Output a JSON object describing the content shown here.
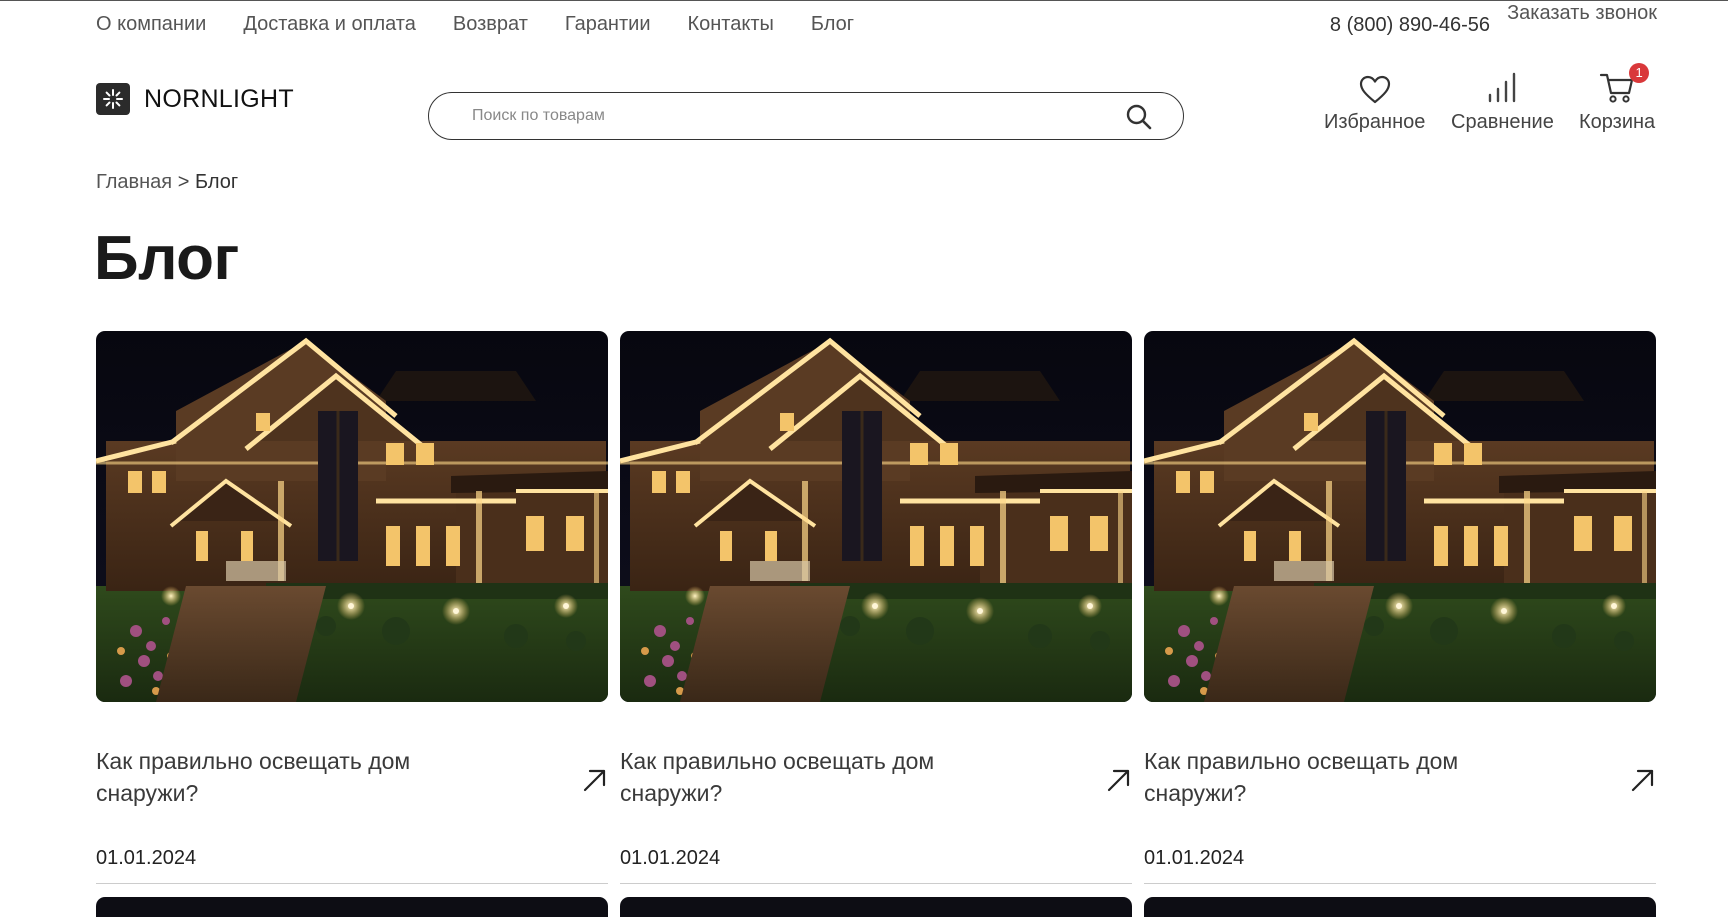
{
  "top_nav": [
    {
      "label": "О компании"
    },
    {
      "label": "Доставка и оплата"
    },
    {
      "label": "Возврат"
    },
    {
      "label": "Гарантии"
    },
    {
      "label": "Контакты"
    },
    {
      "label": "Блог"
    }
  ],
  "contact": {
    "phone": "8 (800) 890-46-56",
    "callback_label": "Заказать звонок"
  },
  "logo": {
    "text": "NORNLIGHT",
    "icon": "sparkle-icon"
  },
  "search": {
    "placeholder": "Поиск по товарам",
    "value": "",
    "icon": "search-icon"
  },
  "header_actions": {
    "favorites": {
      "label": "Избранное",
      "icon": "heart-icon"
    },
    "compare": {
      "label": "Сравнение",
      "icon": "bar-chart-icon"
    },
    "cart": {
      "label": "Корзина",
      "icon": "cart-icon",
      "count": "1"
    }
  },
  "breadcrumb": {
    "home": "Главная",
    "separator": ">",
    "current": "Блог"
  },
  "page": {
    "title": "Блог"
  },
  "posts": [
    {
      "title": "Как правильно освещать дом снаружи?",
      "date": "01.01.2024",
      "image": "lit-house-night-photo"
    },
    {
      "title": "Как правильно освещать дом снаружи?",
      "date": "01.01.2024",
      "image": "lit-house-night-photo"
    },
    {
      "title": "Как правильно освещать дом снаружи?",
      "date": "01.01.2024",
      "image": "lit-house-night-photo"
    }
  ],
  "colors": {
    "text": "#222222",
    "muted": "#555555",
    "badge": "#d9383a",
    "logo_bg": "#2b2b2b",
    "night_sky": "#0d0d1a",
    "warm_light": "#ffd98a"
  }
}
